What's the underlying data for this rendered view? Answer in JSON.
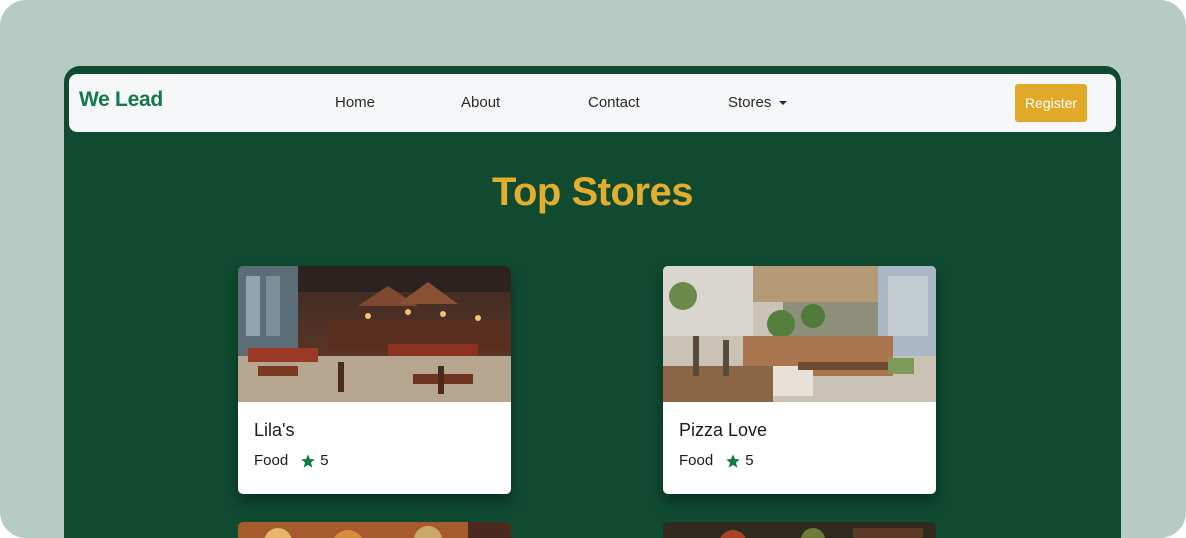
{
  "navbar": {
    "brand": "We Lead",
    "links": [
      "Home",
      "About",
      "Contact",
      "Stores"
    ],
    "register_label": "Register"
  },
  "main": {
    "title": "Top Stores",
    "stores": [
      {
        "name": "Lila's",
        "category": "Food",
        "rating": "5"
      },
      {
        "name": "Pizza Love",
        "category": "Food",
        "rating": "5"
      }
    ]
  },
  "colors": {
    "background": "#0f4a31",
    "brand": "#127a45",
    "accent": "#e5ad2d",
    "star": "#127a45"
  },
  "icons": {
    "dropdown": "caret-down-icon",
    "rating": "star-icon"
  }
}
